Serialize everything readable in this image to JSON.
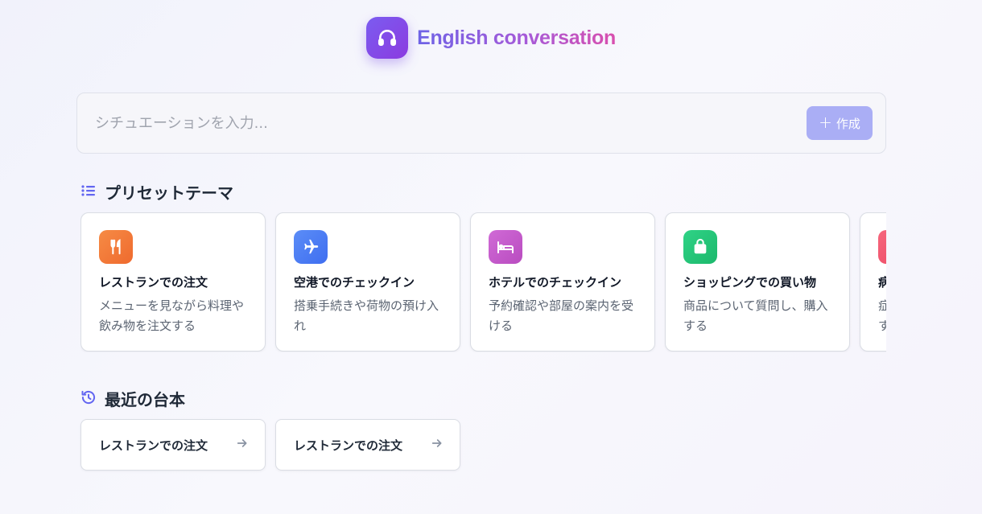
{
  "app": {
    "title": "English conversation"
  },
  "colors": {
    "brand": "#7c4ded",
    "button_disabled": "#aaaef5",
    "accent": "#6366f1"
  },
  "search": {
    "placeholder": "シチュエーションを入力...",
    "value": "",
    "button_label": "作成"
  },
  "presets": {
    "title": "プリセットテーマ",
    "items": [
      {
        "icon": "utensils-icon",
        "color": "#f5793b",
        "title": "レストランでの注文",
        "desc": "メニューを見ながら料理や飲み物を注文する"
      },
      {
        "icon": "airplane-icon",
        "color": "#4f7cf5",
        "title": "空港でのチェックイン",
        "desc": "搭乗手続きや荷物の預け入れ"
      },
      {
        "icon": "bed-icon",
        "color": "#c65ac8",
        "title": "ホテルでのチェックイン",
        "desc": "予約確認や部屋の案内を受ける"
      },
      {
        "icon": "shopping-bag-icon",
        "color": "#22c57a",
        "title": "ショッピングでの買い物",
        "desc": "商品について質問し、購入する"
      },
      {
        "icon": "medical-icon",
        "color": "#f0556e",
        "title": "病院での受診",
        "desc": "症状を説明して医師に相談する"
      }
    ]
  },
  "recent": {
    "title": "最近の台本",
    "items": [
      {
        "label": "レストランでの注文"
      },
      {
        "label": "レストランでの注文"
      }
    ]
  }
}
